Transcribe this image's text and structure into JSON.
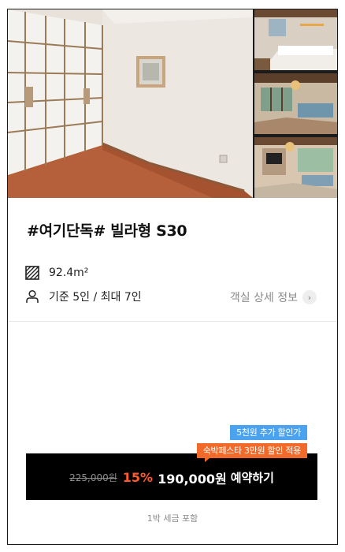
{
  "room": {
    "title": "#여기단독# 빌라형 S30",
    "area": "92.4m²",
    "capacity": "기준 5인 / 최대 7인",
    "detail_link_label": "객실 상세 정보"
  },
  "gallery": {
    "main_photo": "room-with-sliding-paper-doors-photo",
    "thumbnails": [
      "bedroom-photo",
      "living-room-photo",
      "living-room-fireplace-photo"
    ]
  },
  "badges": {
    "extra_discount": "5천원 추가 할인가",
    "festa_discount": "숙박페스타 3만원 할인 적용"
  },
  "price": {
    "original": "225,000원",
    "discount_rate": "15%",
    "final": "190,000원",
    "reserve_label": "예약하기"
  },
  "tax_note": "1박 세금 포함",
  "colors": {
    "accent_orange": "#f26a2a",
    "discount_text": "#ff5a2c",
    "badge_blue": "#4ba3f0",
    "button_bg": "#000000"
  }
}
